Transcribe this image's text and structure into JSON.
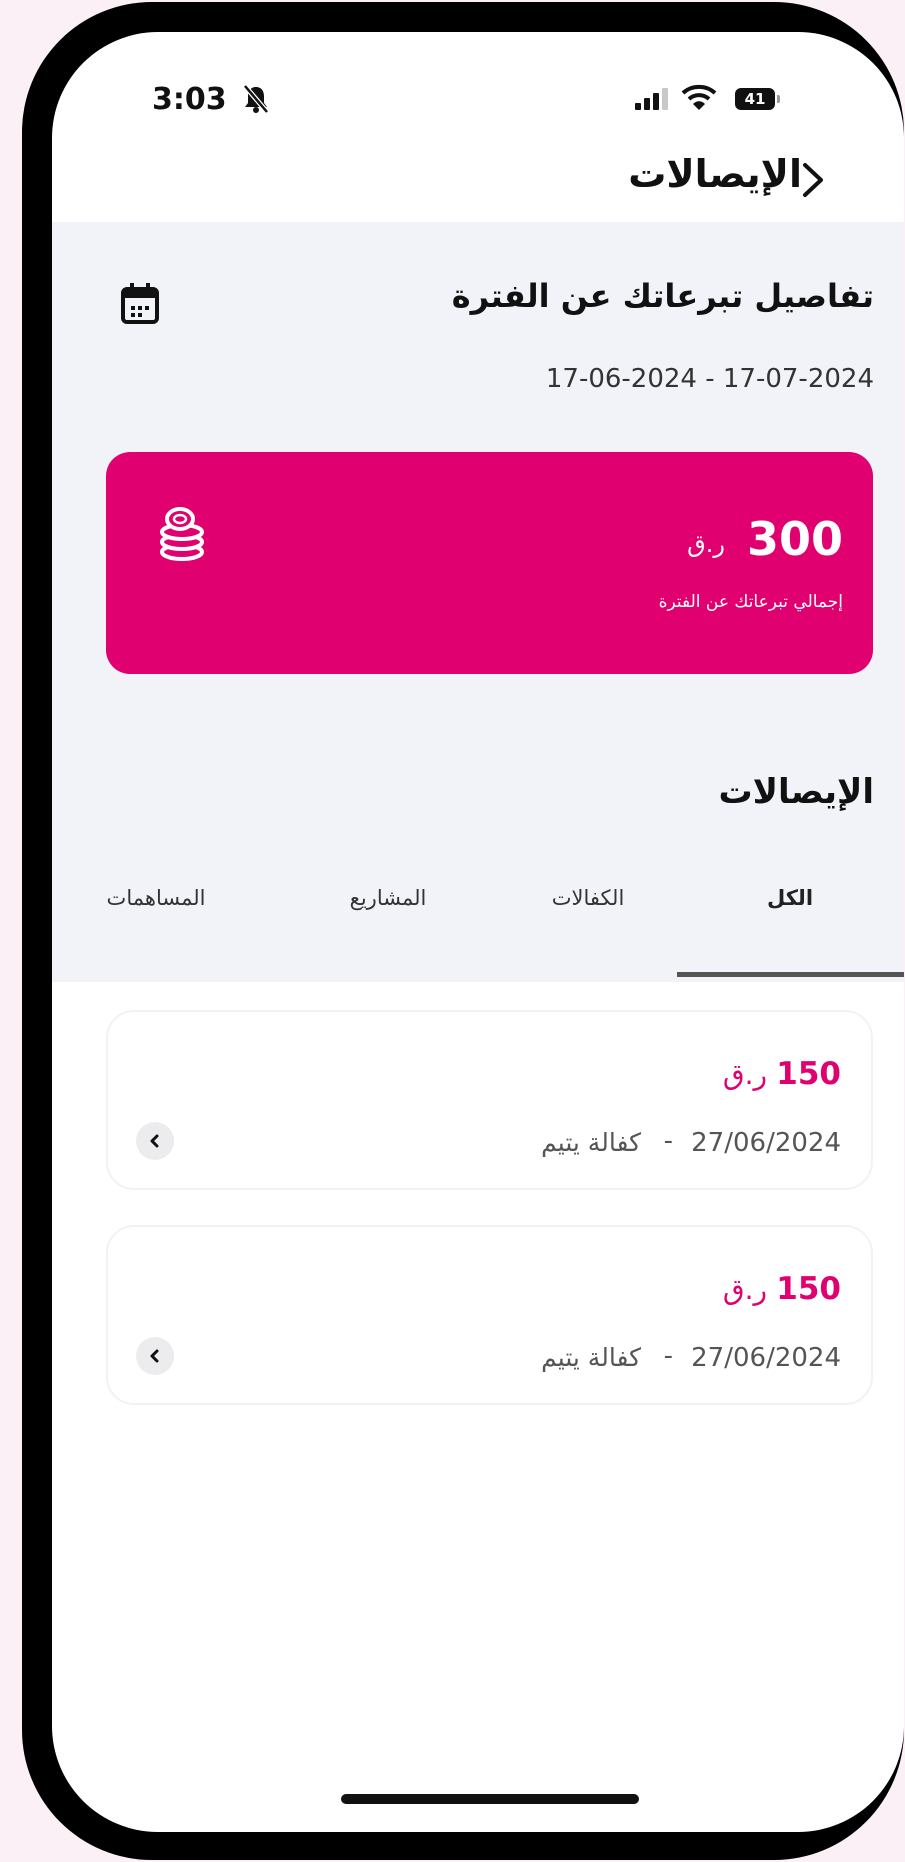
{
  "status_bar": {
    "time": "3:03",
    "battery": "41"
  },
  "header": {
    "title": "الإيصالات"
  },
  "period": {
    "title": "تفاصيل تبرعاتك عن الفترة",
    "date_range": "17-06-2024  -  17-07-2024"
  },
  "total": {
    "amount": "300",
    "currency": "ر.ق",
    "label": "إجمالي تبرعاتك عن الفترة",
    "card_color": "#e0006f"
  },
  "receipts_title": "الإيصالات",
  "tabs": [
    {
      "label": "الكل",
      "active": true
    },
    {
      "label": "الكفالات",
      "active": false
    },
    {
      "label": "المشاريع",
      "active": false
    },
    {
      "label": "المساهمات",
      "active": false
    }
  ],
  "receipts": [
    {
      "amount": "150",
      "currency": "ر.ق",
      "date": "27/06/2024",
      "separator": "-",
      "type": "كفالة يتيم"
    },
    {
      "amount": "150",
      "currency": "ر.ق",
      "date": "27/06/2024",
      "separator": "-",
      "type": "كفالة يتيم"
    }
  ]
}
